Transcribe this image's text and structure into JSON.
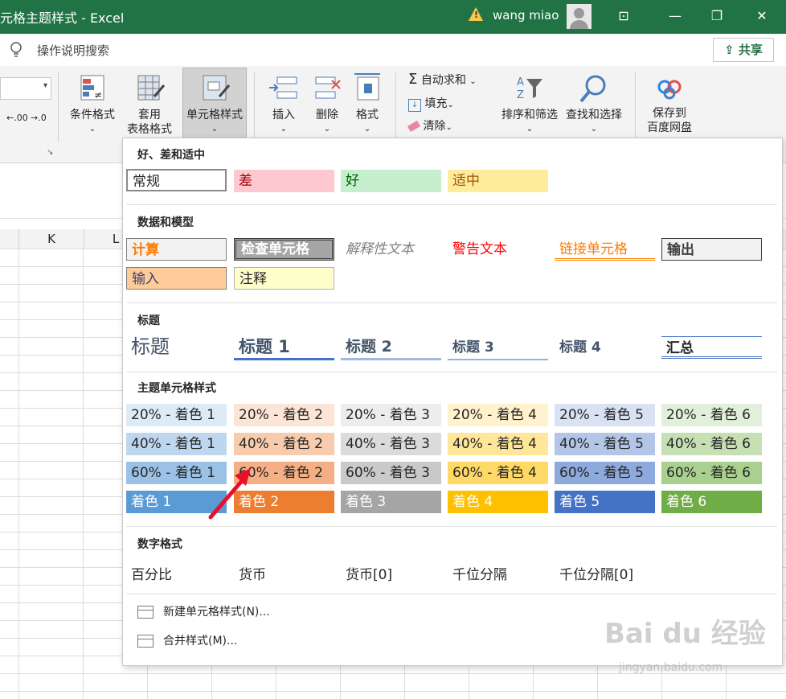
{
  "titlebar": {
    "title": "元格主题样式  -  Excel",
    "user": "wang miao",
    "warning_icon": "warning-icon"
  },
  "tell": {
    "placeholder": "操作说明搜索",
    "share": "共享"
  },
  "ribbon": {
    "conditional_format": "条件格式",
    "table_format_1": "套用",
    "table_format_2": "表格格式",
    "cell_styles": "单元格样式",
    "insert": "插入",
    "delete": "删除",
    "format": "格式",
    "autosum": "自动求和",
    "fill": "填充",
    "clear": "清除",
    "sort_filter": "排序和筛选",
    "find_select": "查找和选择",
    "save_to_1": "保存到",
    "save_to_2": "百度网盘",
    "dec_inc": ".00",
    "dec_dec": ".0"
  },
  "columns": [
    "K",
    "L"
  ],
  "panel": {
    "sections": {
      "good_bad": "好、差和适中",
      "data_model": "数据和模型",
      "titles": "标题",
      "theme": "主题单元格样式",
      "number": "数字格式"
    },
    "good_bad": [
      "常规",
      "差",
      "好",
      "适中"
    ],
    "data_model": [
      "计算",
      "检查单元格",
      "解释性文本",
      "警告文本",
      "链接单元格",
      "输出",
      "输入",
      "注释"
    ],
    "titles": [
      "标题",
      "标题 1",
      "标题 2",
      "标题 3",
      "标题 4",
      "汇总"
    ],
    "theme": {
      "row20": [
        "20% - 着色 1",
        "20% - 着色 2",
        "20% - 着色 3",
        "20% - 着色 4",
        "20% - 着色 5",
        "20% - 着色 6"
      ],
      "row40": [
        "40% - 着色 1",
        "40% - 着色 2",
        "40% - 着色 3",
        "40% - 着色 4",
        "40% - 着色 5",
        "40% - 着色 6"
      ],
      "row60": [
        "60% - 着色 1",
        "60% - 着色 2",
        "60% - 着色 3",
        "60% - 着色 4",
        "60% - 着色 5",
        "60% - 着色 6"
      ],
      "rowfull": [
        "着色 1",
        "着色 2",
        "着色 3",
        "着色 4",
        "着色 5",
        "着色 6"
      ]
    },
    "number": [
      "百分比",
      "货币",
      "货币[0]",
      "千位分隔",
      "千位分隔[0]"
    ],
    "menu": [
      "新建单元格样式(N)...",
      "合并样式(M)..."
    ]
  },
  "watermark": {
    "brand": "Bai du 经验",
    "url": "jingyan.baidu.com"
  },
  "colors": {
    "excel_green": "#217346",
    "arrow_red": "#e8102a"
  }
}
